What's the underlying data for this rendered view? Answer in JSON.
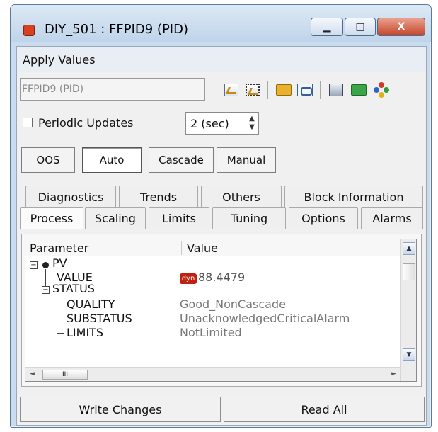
{
  "window": {
    "title": "DIY_501 : FFPID9 (PID)",
    "minimize_glyph": "▁",
    "maximize_glyph": "□",
    "close_glyph": "X"
  },
  "menu": {
    "apply_values": "Apply Values"
  },
  "toolbar": {
    "tag_value": "FFPID9 (PID)",
    "icons": [
      "edit-icon",
      "edit-highlight-icon",
      "open-folder-icon",
      "tree-view-icon",
      "computer-icon",
      "green-folder-icon",
      "color-dots-icon"
    ]
  },
  "periodic": {
    "label": "Periodic Updates",
    "checked": false,
    "interval_value": "2 (sec)"
  },
  "modes": {
    "oos": "OOS",
    "auto": "Auto",
    "cascade": "Cascade",
    "manual": "Manual",
    "active": "Auto"
  },
  "tabs": {
    "back_row": [
      "Diagnostics",
      "Trends",
      "Others",
      "Block Information"
    ],
    "front_row": [
      "Process",
      "Scaling",
      "Limits",
      "Tuning",
      "Options",
      "Alarms"
    ],
    "active": "Process"
  },
  "table": {
    "col_parameter": "Parameter",
    "col_value": "Value",
    "rows": {
      "pv": {
        "label": "PV",
        "value": ""
      },
      "value": {
        "label": "VALUE",
        "badge": "dyn",
        "value": "88.4479"
      },
      "status": {
        "label": "STATUS",
        "value": ""
      },
      "quality": {
        "label": "QUALITY",
        "value": "Good_NonCascade"
      },
      "substatus": {
        "label": "SUBSTATUS",
        "value": "UnacknowledgedCriticalAlarm"
      },
      "limits": {
        "label": "LIMITS",
        "value": "NotLimited"
      }
    },
    "hscroll_grip": "III",
    "expand_minus": "−"
  },
  "actions": {
    "write_changes": "Write Changes",
    "read_all": "Read All"
  },
  "colors": {
    "window_frame": "#c9dbee",
    "close_button": "#c4462a",
    "app_icon": "#d8411e",
    "dyn_badge": "#c0200f"
  }
}
